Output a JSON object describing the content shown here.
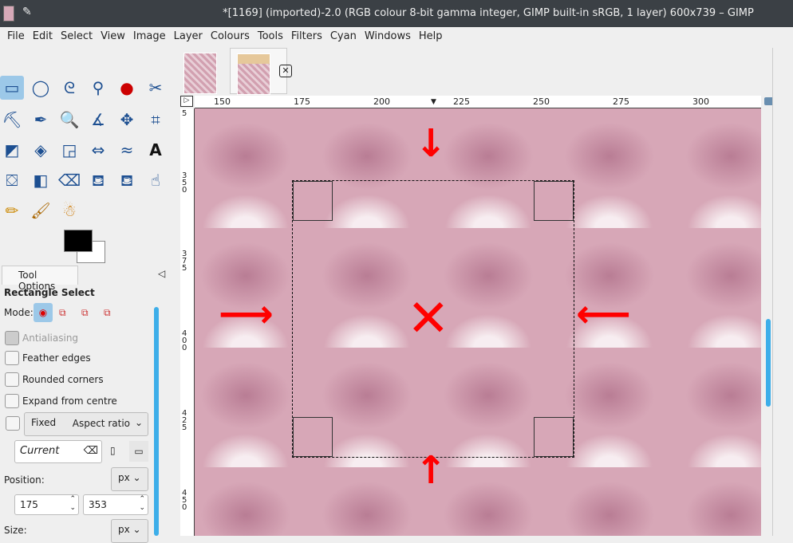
{
  "window": {
    "title": "*[1169] (imported)-2.0 (RGB colour 8-bit gamma integer, GIMP built-in sRGB, 1 layer) 600x739 – GIMP"
  },
  "menu": [
    "File",
    "Edit",
    "Select",
    "View",
    "Image",
    "Layer",
    "Colours",
    "Tools",
    "Filters",
    "Cyan",
    "Windows",
    "Help"
  ],
  "tool_options": {
    "tab_label": "Tool Options",
    "tool_name": "Rectangle Select",
    "mode_label": "Mode:",
    "antialiasing": "Antialiasing",
    "feather": "Feather edges",
    "rounded": "Rounded corners",
    "expand": "Expand from centre",
    "fixed": "Fixed",
    "fixed_option": "Aspect ratio",
    "current": "Current",
    "position_label": "Position:",
    "position_unit": "px",
    "pos_x": "175",
    "pos_y": "353",
    "size_label": "Size:",
    "size_unit": "px"
  },
  "ruler_h": [
    "150",
    "175",
    "200",
    "225",
    "250",
    "275",
    "300"
  ],
  "ruler_v": [
    "5",
    "350",
    "375",
    "400",
    "425",
    "450"
  ]
}
